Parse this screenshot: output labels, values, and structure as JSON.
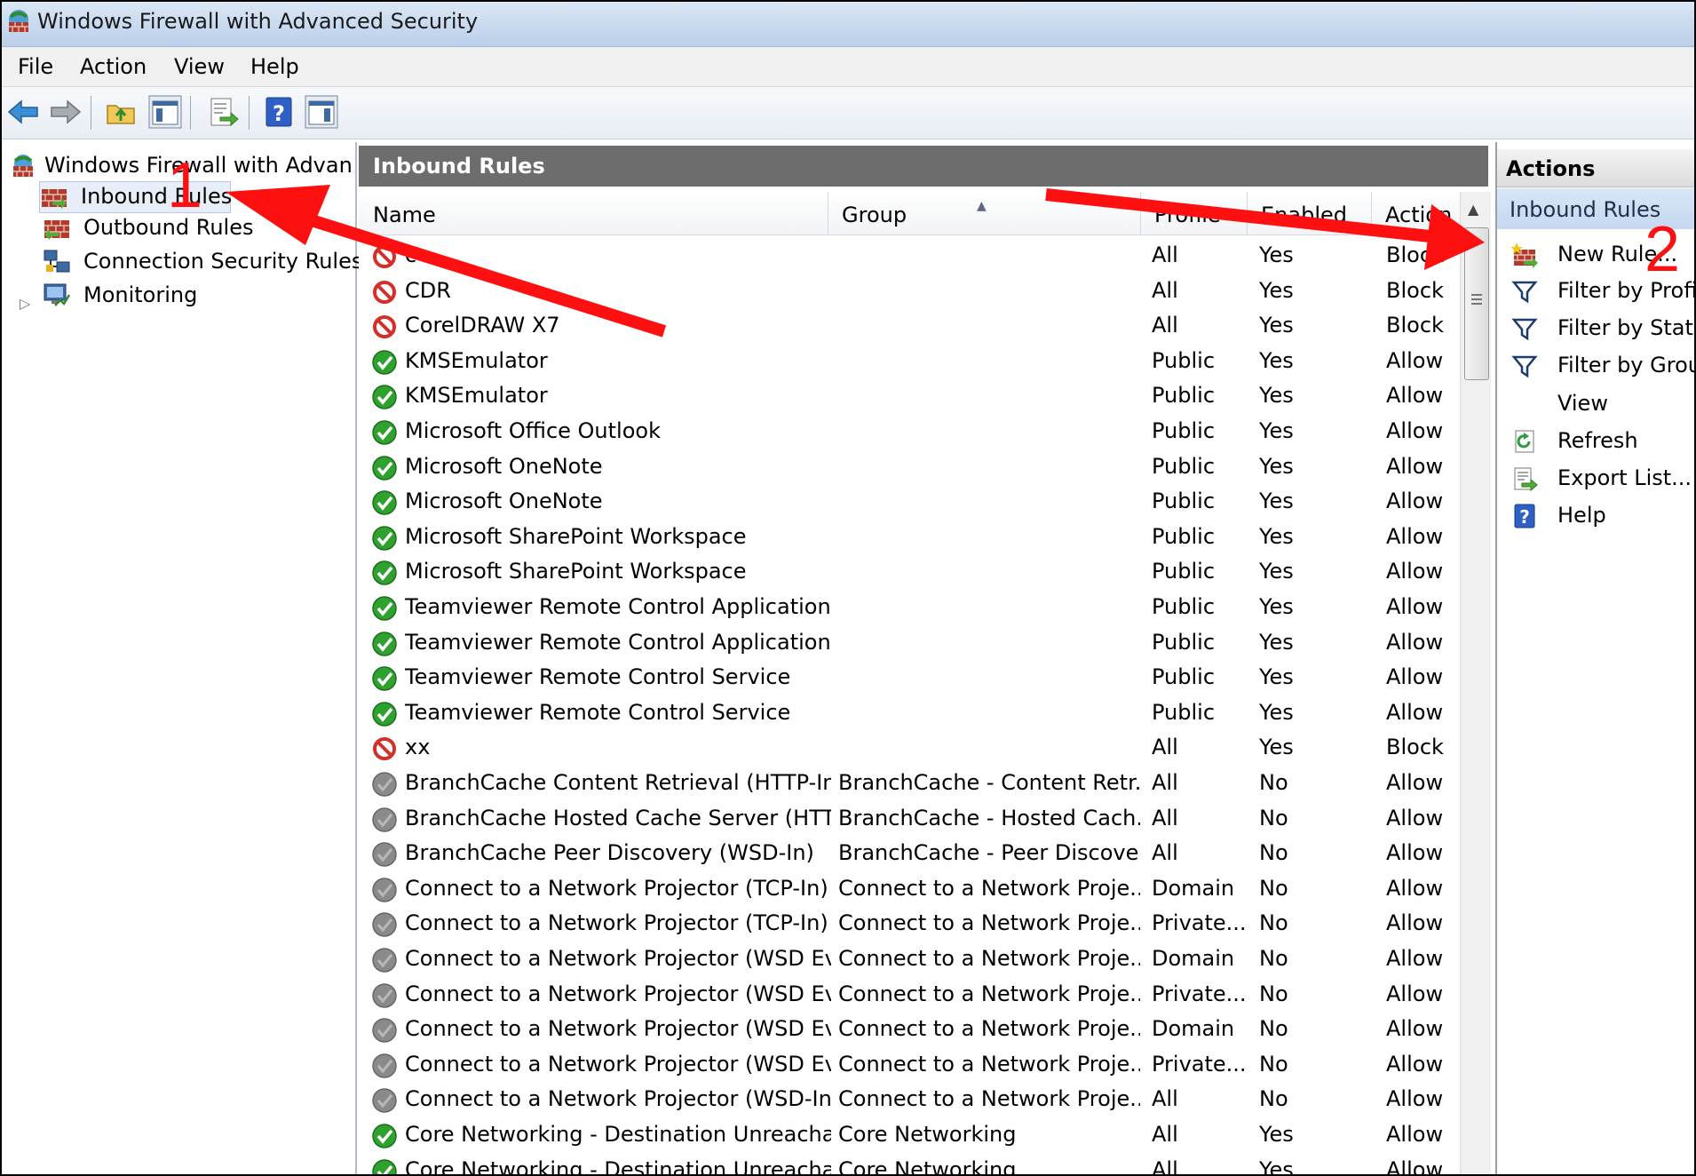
{
  "window": {
    "title": "Windows Firewall with Advanced Security"
  },
  "menu": [
    "File",
    "Action",
    "View",
    "Help"
  ],
  "toolbar": {
    "icons": [
      "back-arrow-icon",
      "forward-arrow-icon",
      "up-folder-icon",
      "show-hide-console-tree-icon",
      "export-list-icon",
      "help-icon",
      "show-hide-action-pane-icon"
    ]
  },
  "tree": {
    "root": "Windows Firewall with Advance",
    "items": [
      "Inbound Rules",
      "Outbound Rules",
      "Connection Security Rules",
      "Monitoring"
    ]
  },
  "pane": {
    "title": "Inbound Rules",
    "columns": [
      "Name",
      "Group",
      "Profile",
      "Enabled",
      "Action"
    ],
    "rows": [
      {
        "status": "block",
        "name": "c",
        "group": "",
        "profile": "All",
        "enabled": "Yes",
        "action": "Block"
      },
      {
        "status": "block",
        "name": "CDR",
        "group": "",
        "profile": "All",
        "enabled": "Yes",
        "action": "Block"
      },
      {
        "status": "block",
        "name": "CorelDRAW X7",
        "group": "",
        "profile": "All",
        "enabled": "Yes",
        "action": "Block"
      },
      {
        "status": "allow",
        "name": "KMSEmulator",
        "group": "",
        "profile": "Public",
        "enabled": "Yes",
        "action": "Allow"
      },
      {
        "status": "allow",
        "name": "KMSEmulator",
        "group": "",
        "profile": "Public",
        "enabled": "Yes",
        "action": "Allow"
      },
      {
        "status": "allow",
        "name": "Microsoft Office Outlook",
        "group": "",
        "profile": "Public",
        "enabled": "Yes",
        "action": "Allow"
      },
      {
        "status": "allow",
        "name": "Microsoft OneNote",
        "group": "",
        "profile": "Public",
        "enabled": "Yes",
        "action": "Allow"
      },
      {
        "status": "allow",
        "name": "Microsoft OneNote",
        "group": "",
        "profile": "Public",
        "enabled": "Yes",
        "action": "Allow"
      },
      {
        "status": "allow",
        "name": "Microsoft SharePoint Workspace",
        "group": "",
        "profile": "Public",
        "enabled": "Yes",
        "action": "Allow"
      },
      {
        "status": "allow",
        "name": "Microsoft SharePoint Workspace",
        "group": "",
        "profile": "Public",
        "enabled": "Yes",
        "action": "Allow"
      },
      {
        "status": "allow",
        "name": "Teamviewer Remote Control Application",
        "group": "",
        "profile": "Public",
        "enabled": "Yes",
        "action": "Allow"
      },
      {
        "status": "allow",
        "name": "Teamviewer Remote Control Application",
        "group": "",
        "profile": "Public",
        "enabled": "Yes",
        "action": "Allow"
      },
      {
        "status": "allow",
        "name": "Teamviewer Remote Control Service",
        "group": "",
        "profile": "Public",
        "enabled": "Yes",
        "action": "Allow"
      },
      {
        "status": "allow",
        "name": "Teamviewer Remote Control Service",
        "group": "",
        "profile": "Public",
        "enabled": "Yes",
        "action": "Allow"
      },
      {
        "status": "block",
        "name": "xx",
        "group": "",
        "profile": "All",
        "enabled": "Yes",
        "action": "Block"
      },
      {
        "status": "disabled",
        "name": "BranchCache Content Retrieval (HTTP-In)",
        "group": "BranchCache - Content Retr...",
        "profile": "All",
        "enabled": "No",
        "action": "Allow"
      },
      {
        "status": "disabled",
        "name": "BranchCache Hosted Cache Server (HTT...",
        "group": "BranchCache - Hosted Cach...",
        "profile": "All",
        "enabled": "No",
        "action": "Allow"
      },
      {
        "status": "disabled",
        "name": "BranchCache Peer Discovery (WSD-In)",
        "group": "BranchCache - Peer Discove...",
        "profile": "All",
        "enabled": "No",
        "action": "Allow"
      },
      {
        "status": "disabled",
        "name": "Connect to a Network Projector (TCP-In)",
        "group": "Connect to a Network Proje...",
        "profile": "Domain",
        "enabled": "No",
        "action": "Allow"
      },
      {
        "status": "disabled",
        "name": "Connect to a Network Projector (TCP-In)",
        "group": "Connect to a Network Proje...",
        "profile": "Private...",
        "enabled": "No",
        "action": "Allow"
      },
      {
        "status": "disabled",
        "name": "Connect to a Network Projector (WSD Ev...",
        "group": "Connect to a Network Proje...",
        "profile": "Domain",
        "enabled": "No",
        "action": "Allow"
      },
      {
        "status": "disabled",
        "name": "Connect to a Network Projector (WSD Ev...",
        "group": "Connect to a Network Proje...",
        "profile": "Private...",
        "enabled": "No",
        "action": "Allow"
      },
      {
        "status": "disabled",
        "name": "Connect to a Network Projector (WSD Ev...",
        "group": "Connect to a Network Proje...",
        "profile": "Domain",
        "enabled": "No",
        "action": "Allow"
      },
      {
        "status": "disabled",
        "name": "Connect to a Network Projector (WSD Ev...",
        "group": "Connect to a Network Proje...",
        "profile": "Private...",
        "enabled": "No",
        "action": "Allow"
      },
      {
        "status": "disabled",
        "name": "Connect to a Network Projector (WSD-In)",
        "group": "Connect to a Network Proje...",
        "profile": "All",
        "enabled": "No",
        "action": "Allow"
      },
      {
        "status": "allow",
        "name": "Core Networking - Destination Unreacha...",
        "group": "Core Networking",
        "profile": "All",
        "enabled": "Yes",
        "action": "Allow"
      },
      {
        "status": "allow",
        "name": "Core Networking - Destination Unreacha...",
        "group": "Core Networking",
        "profile": "All",
        "enabled": "Yes",
        "action": "Allow"
      }
    ]
  },
  "actions": {
    "title": "Actions",
    "section": "Inbound Rules",
    "items": [
      {
        "label": "New Rule...",
        "icon": "new-rule-icon"
      },
      {
        "label": "Filter by Profile",
        "icon": "filter-icon"
      },
      {
        "label": "Filter by State",
        "icon": "filter-icon"
      },
      {
        "label": "Filter by Group",
        "icon": "filter-icon"
      },
      {
        "label": "View",
        "icon": ""
      },
      {
        "label": "Refresh",
        "icon": "refresh-icon"
      },
      {
        "label": "Export List...",
        "icon": "export-list-icon"
      },
      {
        "label": "Help",
        "icon": "help-icon"
      }
    ]
  },
  "annotations": [
    "1",
    "2"
  ],
  "colors": {
    "annotation": "#ff1010",
    "allow": "#2fa12f",
    "block": "#d4302b",
    "disabled": "#8a8a8a",
    "pane_header": "#6d6d6d",
    "actions_sub": "#c4d8f1"
  }
}
